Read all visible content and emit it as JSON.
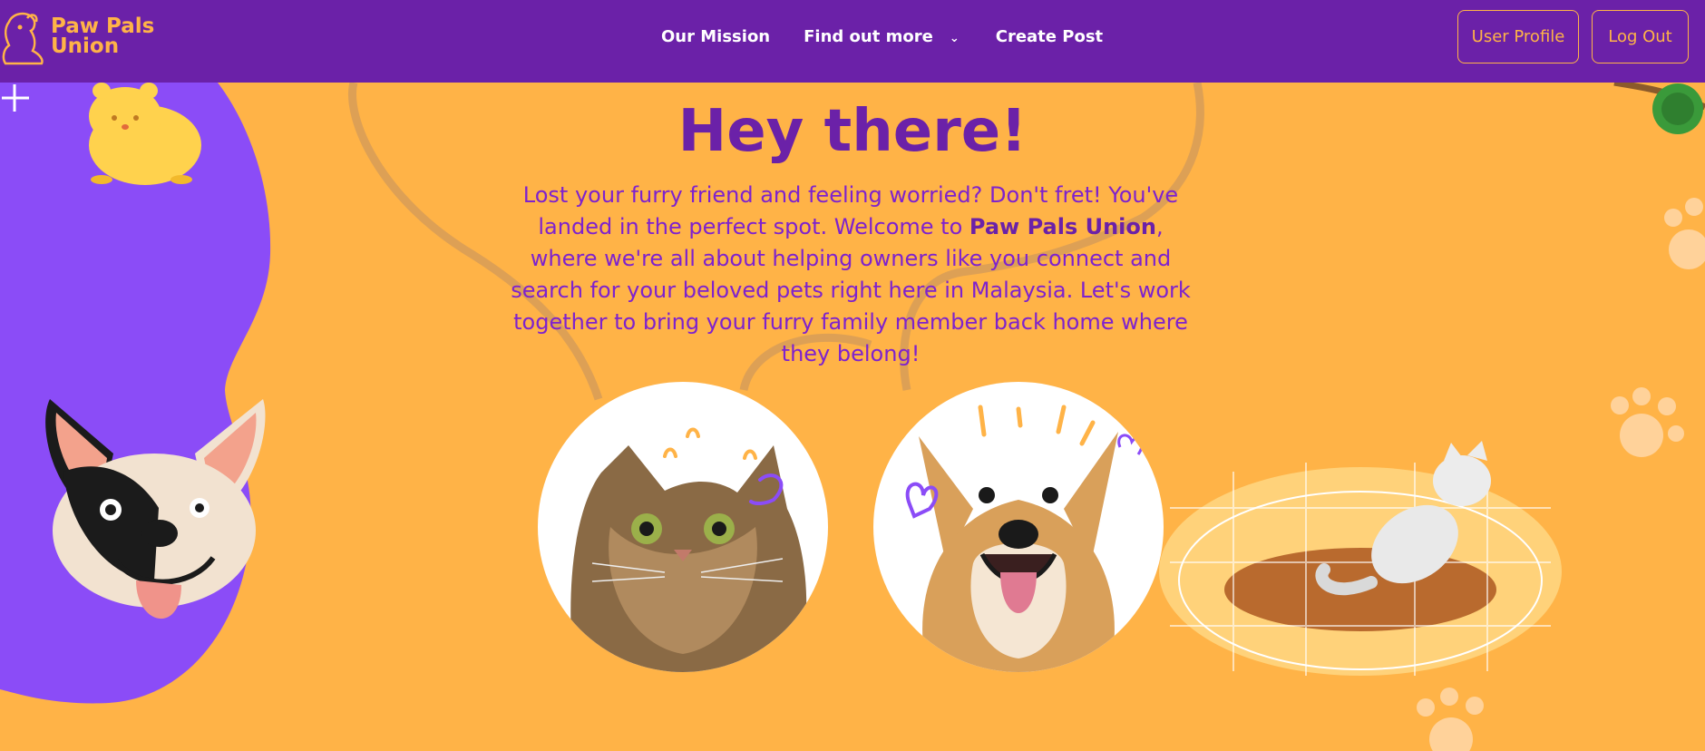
{
  "brand": {
    "line1": "Paw Pals",
    "line2": "Union",
    "logo_icon": "dog-logo-icon"
  },
  "nav": {
    "links": [
      {
        "label": "Our Mission"
      },
      {
        "label": "Find out more"
      },
      {
        "label": "Create Post"
      }
    ],
    "dropdown_icon": "chevron-down-icon",
    "buttons": {
      "profile": "User Profile",
      "logout": "Log Out"
    }
  },
  "hero": {
    "title": "Hey there!",
    "text_before": "Lost your furry friend and feeling worried? Don't fret! You've landed in the perfect spot. Welcome to ",
    "brand_name": "Paw Pals Union",
    "text_after": ", where we're all about helping owners like you connect and search for your beloved pets right here in Malaysia. Let's work together to bring your furry family member back home where they belong!"
  },
  "images": [
    {
      "name": "cat-photo"
    },
    {
      "name": "dog-photo"
    }
  ],
  "colors": {
    "primary": "#6b21a8",
    "accent": "#ffb347",
    "blob": "#8b4cf7",
    "text": "#7e22ce"
  }
}
